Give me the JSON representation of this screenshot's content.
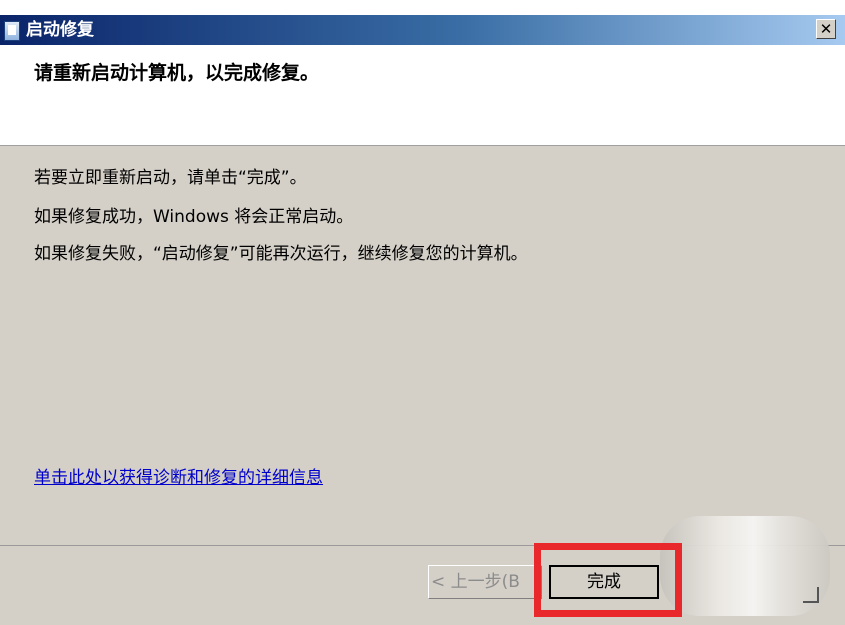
{
  "window": {
    "title": "启动修复",
    "close_label": "✕"
  },
  "header": {
    "text": "请重新启动计算机，以完成修复。"
  },
  "body": {
    "line1": "若要立即重新启动，请单击“完成”。",
    "line2": "如果修复成功，Windows 将会正常启动。",
    "line3": "如果修复失败，“启动修复”可能再次运行，继续修复您的计算机。",
    "link": "单击此处以获得诊断和修复的详细信息"
  },
  "footer": {
    "back_label": "< 上一步(B",
    "finish_label": "完成"
  },
  "colors": {
    "highlight": "#e8282a",
    "link": "#0000cc",
    "dialog_bg": "#d4d0c8"
  },
  "icons": [
    "app-icon",
    "close-icon"
  ]
}
